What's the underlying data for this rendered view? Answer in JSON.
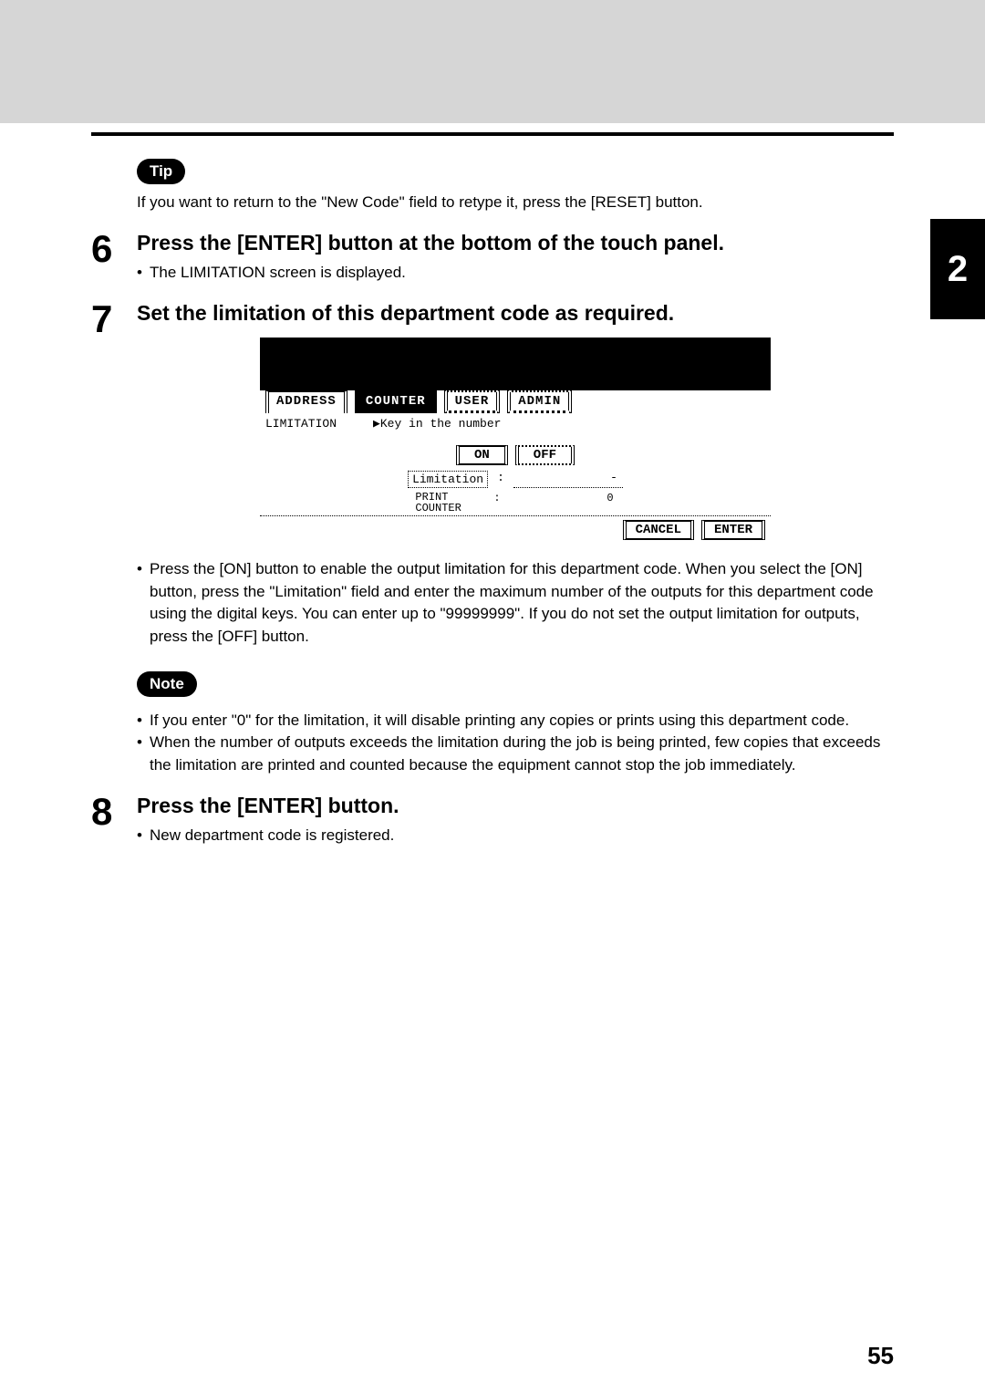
{
  "side_tab": "2",
  "page_number": "55",
  "tip": {
    "badge": "Tip",
    "text": "If you want to return to the \"New Code\" field to retype it, press the [RESET] button."
  },
  "steps": {
    "s6": {
      "num": "6",
      "title": "Press the [ENTER] button at the bottom of the touch panel.",
      "bullets": [
        "The LIMITATION screen is displayed."
      ]
    },
    "s7": {
      "num": "7",
      "title": "Set the limitation of this department code as required.",
      "bullets": [
        "Press the [ON] button to enable the output limitation for this department code. When you select the [ON] button, press the \"Limitation\" field and enter the maximum number of the outputs for this department code using the digital keys. You can enter up to \"99999999\". If you do not set the output limitation for outputs, press the [OFF] button."
      ]
    },
    "s8": {
      "num": "8",
      "title": "Press the [ENTER] button.",
      "bullets": [
        "New department code is registered."
      ]
    }
  },
  "note": {
    "badge": "Note",
    "bullets": [
      "If you enter \"0\" for the limitation, it will disable printing any copies or prints using this department code.",
      "When the number of outputs exceeds the limitation during the job is being printed, few copies that exceeds the limitation are printed and counted because the equipment cannot stop the job immediately."
    ]
  },
  "screen": {
    "tabs": {
      "address": "ADDRESS",
      "counter": "COUNTER",
      "user": "USER",
      "admin": "ADMIN"
    },
    "body": {
      "label_limitation": "LIMITATION",
      "prompt": "▶Key in the number",
      "on": "ON",
      "off": "OFF",
      "limitation_field": "Limitation",
      "limitation_sep": ":",
      "limitation_val": "-",
      "print_counter_label": "PRINT\nCOUNTER",
      "print_counter_sep": ":",
      "print_counter_val": "0"
    },
    "footer": {
      "cancel": "CANCEL",
      "enter": "ENTER"
    }
  }
}
